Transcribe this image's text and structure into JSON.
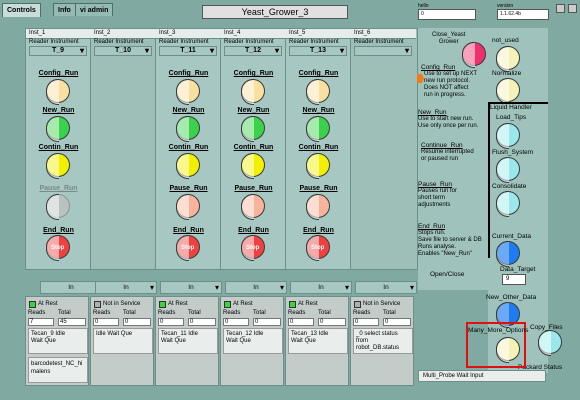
{
  "tabs": [
    {
      "label": "Controls",
      "active": true
    },
    {
      "label": "Info",
      "active": false
    },
    {
      "label": "vi admin",
      "active": false
    }
  ],
  "title": "Yeast_Grower_3",
  "top_fields": {
    "field_a": {
      "label": "hello",
      "value": "0"
    },
    "field_b": {
      "label": "version",
      "value": "1.1.62.4b"
    }
  },
  "instruments": [
    {
      "name": "Inst_1",
      "reader_label": "Reader Instrument",
      "reader": "T_9",
      "active": true,
      "buttons": {
        "config": "Config_Run",
        "new": "New_Run",
        "contin": "Contin_Run",
        "pause": "Pause_Run",
        "end": "End_Run"
      }
    },
    {
      "name": "Inst_2",
      "reader_label": "Reader Instrument",
      "reader": "T_10",
      "active": false
    },
    {
      "name": "Inst_3",
      "reader_label": "Reader Instrument",
      "reader": "T_11",
      "active": true,
      "buttons": {
        "config": "Config_Run",
        "new": "New_Run",
        "contin": "Contin_Run",
        "pause": "Pause_Run",
        "end": "End_Run"
      }
    },
    {
      "name": "Inst_4",
      "reader_label": "Reader Instrument",
      "reader": "T_12",
      "active": true,
      "buttons": {
        "config": "Config_Run",
        "new": "New_Run",
        "contin": "Contin_Run",
        "pause": "Pause_Run",
        "end": "End_Run"
      }
    },
    {
      "name": "Inst_5",
      "reader_label": "Reader Instrument",
      "reader": "T_13",
      "active": true,
      "buttons": {
        "config": "Config_Run",
        "new": "New_Run",
        "contin": "Contin_Run",
        "pause": "Pause_Run",
        "end": "End_Run"
      }
    },
    {
      "name": "Inst_6",
      "reader_label": "Reader Instrument",
      "reader": "",
      "active": false
    }
  ],
  "stop_label": "Stop",
  "bottom_selects": [
    "In",
    "In",
    "In",
    "In",
    "In",
    "In"
  ],
  "open_close_label": "Open/Close",
  "status_cards": [
    {
      "check_label": "At Rest",
      "check_on": true,
      "reads_label": "Reads",
      "total_label": "Total",
      "reads": "7",
      "total": "45",
      "status": "Tecan_9  Idle\nWait Que",
      "extra": "barcodetest_NC_hi\nmalens"
    },
    {
      "check_label": "Not in Service",
      "check_on": false,
      "reads_label": "Reads",
      "total_label": "Total",
      "reads": "0",
      "total": "0",
      "status": "Idle Wait Que",
      "extra": ""
    },
    {
      "check_label": "At Rest",
      "check_on": true,
      "reads_label": "Reads",
      "total_label": "Total",
      "reads": "0",
      "total": "0",
      "status": "Tecan_11  Idle\nWait Que",
      "extra": ""
    },
    {
      "check_label": "At Rest",
      "check_on": true,
      "reads_label": "Reads",
      "total_label": "Total",
      "reads": "0",
      "total": "0",
      "status": "Tecan_12  Idle\nWait Que",
      "extra": ""
    },
    {
      "check_label": "At Rest",
      "check_on": true,
      "reads_label": "Reads",
      "total_label": "Total",
      "reads": "0",
      "total": "0",
      "status": "Tecan_13  Idle\nWait Que",
      "extra": ""
    },
    {
      "check_label": "Not in Service",
      "check_on": false,
      "reads_label": "Reads",
      "total_label": "Total",
      "reads": "0",
      "total": "0",
      "status": "_0 select status\nfrom\nrobot_DB.status",
      "extra": ""
    }
  ],
  "info": {
    "close_label": "Close_Yeast\nGrower",
    "items": [
      {
        "title": "Config_Run",
        "desc": "Use to set up NEXT\nnew run protocol.\nDoes NOT affect\nrun in progress."
      },
      {
        "title": "New_Run",
        "desc": "Use to start new run.\nUse only once per run."
      },
      {
        "title": "Continue_Run",
        "desc": "Resume interrupted\nor paused run"
      },
      {
        "title": "Pause_Run",
        "desc": "Pauses run for\nshort term\nadjustments"
      },
      {
        "title": "End_Run",
        "desc": "Stops run.\nSave file to server & DB\nRuns analyse.\nEnables \"New_Run\""
      }
    ]
  },
  "right": {
    "not_used": "not_used",
    "normalize": "Normalize",
    "liquid_handler": "Liquid Handler",
    "load_tips": "Load_Tips",
    "flush_system": "Flush_System",
    "consolidate": "Consolidate",
    "current_data": "Current_Data",
    "data_target_label": "Data_Target",
    "data_target_value": "9",
    "new_other_data": "New_Other_Data",
    "many_more": "Many_More_Options",
    "copy_files": "Copy_Files",
    "packard_status": "Packard Status"
  },
  "multi_probe": "Multi_Probe Wait Input",
  "colors": {
    "background": "#7fa9a1",
    "panel": "#a7c8c2",
    "green": "#3ad24a",
    "yellow": "#f2f000",
    "red": "#f04040",
    "highlight_box": "#e01010"
  }
}
